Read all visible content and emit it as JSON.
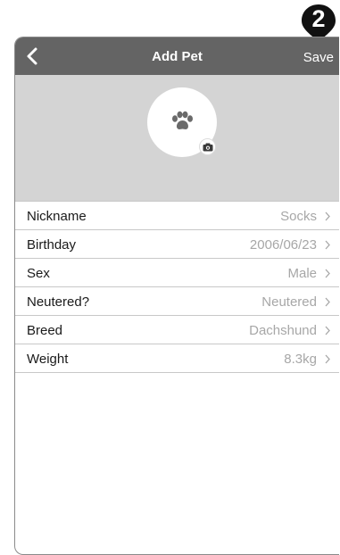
{
  "step_badge": {
    "number": "2"
  },
  "navbar": {
    "back_icon": "chevron-left-icon",
    "title": "Add Pet",
    "save_label": "Save"
  },
  "avatar": {
    "icon": "paw-icon",
    "camera_icon": "camera-icon"
  },
  "fields": [
    {
      "label": "Nickname",
      "value": "Socks"
    },
    {
      "label": "Birthday",
      "value": "2006/06/23"
    },
    {
      "label": "Sex",
      "value": "Male"
    },
    {
      "label": "Neutered?",
      "value": "Neutered"
    },
    {
      "label": "Breed",
      "value": "Dachshund"
    },
    {
      "label": "Weight",
      "value": "8.3kg"
    }
  ],
  "colors": {
    "navbar": "#646464",
    "header_bg": "#d4d4d4",
    "value_text": "#a7a7a7",
    "badge": "#111111"
  }
}
